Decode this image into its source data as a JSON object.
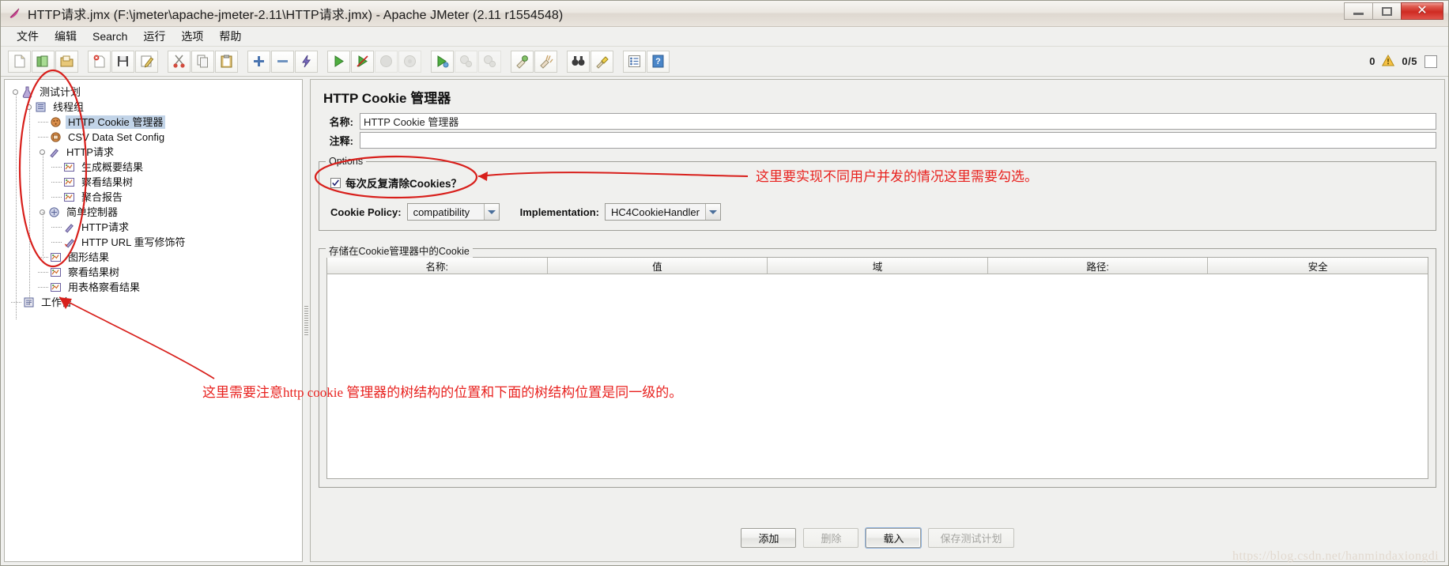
{
  "window": {
    "title": "HTTP请求.jmx (F:\\jmeter\\apache-jmeter-2.11\\HTTP请求.jmx) - Apache JMeter (2.11 r1554548)",
    "icon": "jmeter-feather-icon",
    "minimize_label": "–",
    "maximize_label": "❐",
    "close_label": "✕"
  },
  "menubar": {
    "items": [
      {
        "label": "文件",
        "name": "menu-file"
      },
      {
        "label": "编辑",
        "name": "menu-edit"
      },
      {
        "label": "Search",
        "name": "menu-search"
      },
      {
        "label": "运行",
        "name": "menu-run"
      },
      {
        "label": "选项",
        "name": "menu-options"
      },
      {
        "label": "帮助",
        "name": "menu-help"
      }
    ]
  },
  "toolbar": {
    "groups": [
      [
        {
          "name": "new-icon",
          "title": "新建",
          "disabled": false
        },
        {
          "name": "templates-icon",
          "title": "模板",
          "disabled": false
        },
        {
          "name": "open-icon",
          "title": "打开",
          "disabled": false
        }
      ],
      [
        {
          "name": "close-icon",
          "title": "关闭",
          "disabled": false
        },
        {
          "name": "save-icon",
          "title": "保存",
          "disabled": false
        },
        {
          "name": "save-as-icon",
          "title": "另存为",
          "disabled": false
        }
      ],
      [
        {
          "name": "cut-icon",
          "title": "剪切",
          "disabled": false
        },
        {
          "name": "copy-icon",
          "title": "复制",
          "disabled": false
        },
        {
          "name": "paste-icon",
          "title": "粘贴",
          "disabled": false
        }
      ],
      [
        {
          "name": "expand-all-icon",
          "title": "展开全部",
          "disabled": false
        },
        {
          "name": "collapse-all-icon",
          "title": "折叠全部",
          "disabled": false
        },
        {
          "name": "toggle-icon",
          "title": "启用/禁用",
          "disabled": false
        }
      ],
      [
        {
          "name": "start-icon",
          "title": "启动",
          "disabled": false
        },
        {
          "name": "start-no-pause-icon",
          "title": "无间断启动",
          "disabled": false
        },
        {
          "name": "stop-icon",
          "title": "停止",
          "disabled": true
        },
        {
          "name": "shutdown-icon",
          "title": "关闭",
          "disabled": true
        }
      ],
      [
        {
          "name": "start-remote-icon",
          "title": "远程启动",
          "disabled": false
        },
        {
          "name": "stop-remote-icon",
          "title": "远程停止",
          "disabled": true
        },
        {
          "name": "shutdown-remote-icon",
          "title": "远程关闭",
          "disabled": true
        }
      ],
      [
        {
          "name": "clear-icon",
          "title": "清除",
          "disabled": false
        },
        {
          "name": "clear-all-icon",
          "title": "清除全部",
          "disabled": false
        }
      ],
      [
        {
          "name": "search-binoculars-icon",
          "title": "查找",
          "disabled": false
        },
        {
          "name": "search-reset-icon",
          "title": "重置查找",
          "disabled": false
        }
      ],
      [
        {
          "name": "function-helper-icon",
          "title": "函数助手对话框",
          "disabled": false
        },
        {
          "name": "help-icon",
          "title": "帮助",
          "disabled": false
        }
      ]
    ],
    "status": {
      "warning_count": "0",
      "warning_icon": "warning-triangle-icon",
      "thread_ratio": "0/5"
    }
  },
  "tree": {
    "nodes": [
      {
        "label": "测试计划",
        "icon": "test-plan-icon",
        "depth": 0,
        "handle": "expanded",
        "selected": false
      },
      {
        "label": "线程组",
        "icon": "thread-group-icon",
        "depth": 1,
        "handle": "expanded",
        "selected": false
      },
      {
        "label": "HTTP Cookie 管理器",
        "icon": "cookie-manager-icon",
        "depth": 2,
        "handle": "none",
        "selected": true
      },
      {
        "label": "CSV Data Set Config",
        "icon": "csv-config-icon",
        "depth": 2,
        "handle": "none",
        "selected": false
      },
      {
        "label": "HTTP请求",
        "icon": "http-request-icon",
        "depth": 2,
        "handle": "expanded",
        "selected": false
      },
      {
        "label": "生成概要结果",
        "icon": "listener-icon",
        "depth": 3,
        "handle": "none",
        "selected": false
      },
      {
        "label": "察看结果树",
        "icon": "listener-icon",
        "depth": 3,
        "handle": "none",
        "selected": false
      },
      {
        "label": "聚合报告",
        "icon": "listener-icon",
        "depth": 3,
        "handle": "none",
        "selected": false
      },
      {
        "label": "简单控制器",
        "icon": "simple-controller-icon",
        "depth": 2,
        "handle": "expanded",
        "selected": false
      },
      {
        "label": "HTTP请求",
        "icon": "http-request-icon",
        "depth": 3,
        "handle": "none",
        "selected": false
      },
      {
        "label": "HTTP URL 重写修饰符",
        "icon": "url-rewriter-icon",
        "depth": 3,
        "handle": "none",
        "selected": false
      },
      {
        "label": "图形结果",
        "icon": "listener-icon",
        "depth": 2,
        "handle": "none",
        "selected": false
      },
      {
        "label": "察看结果树",
        "icon": "listener-icon",
        "depth": 2,
        "handle": "none",
        "selected": false
      },
      {
        "label": "用表格察看结果",
        "icon": "listener-icon",
        "depth": 2,
        "handle": "none",
        "selected": false
      },
      {
        "label": "工作台",
        "icon": "workbench-icon",
        "depth": 0,
        "handle": "none",
        "selected": false
      }
    ]
  },
  "panel": {
    "title": "HTTP Cookie 管理器",
    "name_label": "名称:",
    "name_value": "HTTP Cookie 管理器",
    "comment_label": "注释:",
    "comment_value": "",
    "comment_placeholder": "",
    "options": {
      "group_title": "Options",
      "clear_cookies_label": "每次反复清除Cookies？",
      "clear_cookies_checked": true,
      "cookie_policy_label": "Cookie Policy:",
      "cookie_policy_value": "compatibility",
      "implementation_label": "Implementation:",
      "implementation_value": "HC4CookieHandler"
    },
    "cookie_table": {
      "group_title": "存储在Cookie管理器中的Cookie",
      "columns": [
        "名称:",
        "值",
        "域",
        "路径:",
        "安全"
      ],
      "rows": []
    },
    "buttons": [
      {
        "label": "添加",
        "name": "add-button",
        "disabled": false,
        "focused": false
      },
      {
        "label": "删除",
        "name": "delete-button",
        "disabled": true,
        "focused": false
      },
      {
        "label": "载入",
        "name": "load-button",
        "disabled": false,
        "focused": true
      },
      {
        "label": "保存测试计划",
        "name": "save-test-plan-button",
        "disabled": true,
        "focused": false
      }
    ]
  },
  "annotations": {
    "checkbox_note": "这里要实现不同用户并发的情况这里需要勾选。",
    "tree_note": "这里需要注意http cookie 管理器的树结构的位置和下面的树结构位置是同一级的。"
  },
  "watermark": "https://blog.csdn.net/hanmindaxiongdi",
  "colors": {
    "annotation_red": "#e8221f",
    "selection_blue": "#c2d4e8",
    "panel_bg": "#f0f0ee",
    "close_button_red": "#cf2a22"
  }
}
